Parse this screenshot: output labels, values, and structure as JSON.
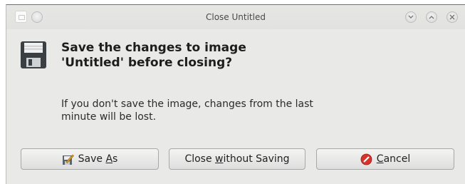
{
  "window": {
    "title": "Close Untitled"
  },
  "dialog": {
    "heading": "Save the changes to image 'Untitled' before closing?",
    "message": "If you don't save the image, changes from the last minute will be lost.",
    "icon": "floppy-disk-icon"
  },
  "buttons": {
    "save_as": {
      "pre": "Save ",
      "mnemonic": "A",
      "post": "s",
      "icon": "save-as-icon"
    },
    "close_without_saving": {
      "pre": "Close ",
      "mnemonic": "w",
      "post": "ithout Saving"
    },
    "cancel": {
      "pre": "",
      "mnemonic": "C",
      "post": "ancel",
      "icon": "cancel-icon"
    }
  },
  "titlebar_buttons": [
    "minimize-icon",
    "maximize-icon",
    "close-icon"
  ],
  "colors": {
    "window_bg": "#e9e9e7",
    "cancel_red": "#d8322c"
  }
}
